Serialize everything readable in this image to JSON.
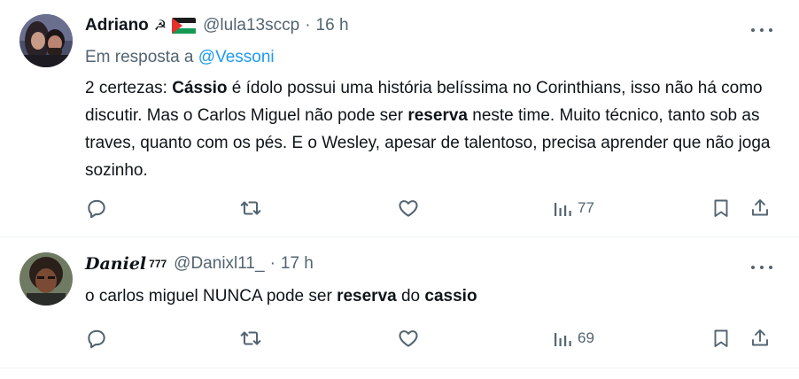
{
  "tweets": [
    {
      "author": "Adriano",
      "hammer_sickle": "☭",
      "handle": "@lula13sccp",
      "time": "16 h",
      "reply_label": "Em resposta a",
      "reply_to": "@Vessoni",
      "text": {
        "p1": "2 certezas: ",
        "b1": "Cássio",
        "p2": " é ídolo possui uma história belíssima no Corinthians, isso não há como discutir. Mas o Carlos Miguel não pode ser ",
        "b2": "reserva",
        "p3": " neste time. Muito técnico, tanto sob as traves, quanto com os pés. E o Wesley, apesar de talentoso, precisa aprender que não joga sozinho."
      },
      "views": "77"
    },
    {
      "author": "Daniel",
      "sup": "777",
      "handle": "@Danixl11_",
      "time": "17 h",
      "text": {
        "p1": "o carlos miguel NUNCA pode ser ",
        "b1": "reserva",
        "p2": " do ",
        "b2": "cassio"
      },
      "views": "69"
    }
  ],
  "separator": "·",
  "icons": [
    "avatar-couple",
    "palestine-flag-icon",
    "more-icon",
    "reply-icon",
    "retweet-icon",
    "like-icon",
    "views-icon",
    "bookmark-icon",
    "share-icon",
    "avatar-cartoon"
  ],
  "colors": {
    "text": "#0f1419",
    "secondary": "#536471",
    "link": "#1d9bf0",
    "divider": "#eff3f4"
  }
}
